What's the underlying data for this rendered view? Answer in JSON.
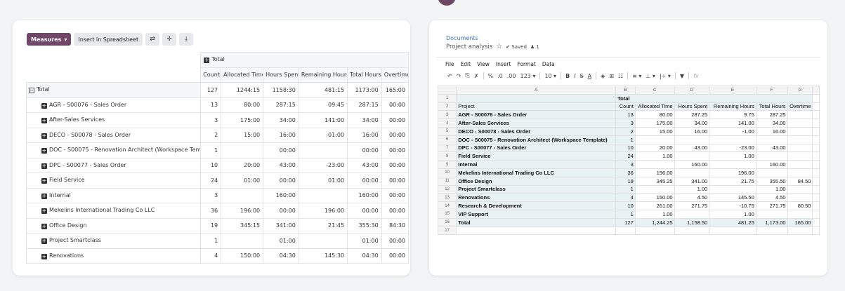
{
  "pivot": {
    "toolbar": {
      "measures": "Measures",
      "insert": "Insert in Spreadsheet",
      "icons": [
        "swap-axis-icon",
        "expand-all-icon",
        "download-icon"
      ]
    },
    "header_total": "Total",
    "columns": [
      "Count",
      "Allocated Time",
      "Hours Spent",
      "Remaining Hours",
      "Total Hours",
      "Overtime"
    ],
    "total_row": {
      "label": "Total",
      "values": [
        "127",
        "1244:15",
        "1158:30",
        "481:15",
        "1173:00",
        "165:00"
      ]
    },
    "rows": [
      {
        "label": "AGR - S00076 - Sales Order",
        "values": [
          "13",
          "80:00",
          "287:15",
          "09:45",
          "287:15",
          "00:00"
        ]
      },
      {
        "label": "After-Sales Services",
        "values": [
          "3",
          "175:00",
          "34:00",
          "141:00",
          "34:00",
          "00:00"
        ]
      },
      {
        "label": "DECO - S00078 - Sales Order",
        "values": [
          "2",
          "15:00",
          "16:00",
          "-01:00",
          "16:00",
          "00:00"
        ]
      },
      {
        "label": "DOC - S00075 - Renovation Architect (Workspace Template)",
        "values": [
          "1",
          "",
          "00:00",
          "",
          "00:00",
          "00:00"
        ]
      },
      {
        "label": "DPC - S00077 - Sales Order",
        "values": [
          "10",
          "20:00",
          "43:00",
          "-23:00",
          "43:00",
          "00:00"
        ]
      },
      {
        "label": "Field Service",
        "values": [
          "24",
          "01:00",
          "00:00",
          "01:00",
          "00:00",
          "00:00"
        ]
      },
      {
        "label": "Internal",
        "values": [
          "3",
          "",
          "160:00",
          "",
          "160:00",
          "00:00"
        ]
      },
      {
        "label": "Mekelins International Trading Co LLC",
        "values": [
          "36",
          "196:00",
          "00:00",
          "196:00",
          "00:00",
          "00:00"
        ]
      },
      {
        "label": "Office Design",
        "values": [
          "19",
          "345:15",
          "341:00",
          "21:45",
          "355:30",
          "84:30"
        ]
      },
      {
        "label": "Project Smartclass",
        "values": [
          "1",
          "",
          "01:00",
          "",
          "01:00",
          "00:00"
        ]
      },
      {
        "label": "Renovations",
        "values": [
          "4",
          "150:00",
          "04:30",
          "145:30",
          "04:30",
          "00:00"
        ]
      }
    ]
  },
  "spreadsheet": {
    "breadcrumb": "Documents",
    "title": "Project analysis",
    "saved": "Saved",
    "user_count": "1",
    "menu": [
      "File",
      "Edit",
      "View",
      "Insert",
      "Format",
      "Data"
    ],
    "toolbar": [
      "↶",
      "↷",
      "⎘",
      "✗",
      "%",
      ".0",
      ".00",
      "123 ▾",
      "10 ▾",
      "B",
      "I",
      "S",
      "A",
      "◈",
      "⊞",
      "☷",
      "≡ ▾",
      "⊥ ▾",
      "|÷ ▾",
      "▼",
      "fx"
    ],
    "col_letters": [
      "A",
      "B",
      "C",
      "D",
      "E",
      "F",
      "G"
    ],
    "row_numbers": [
      "1",
      "2",
      "3",
      "4",
      "5",
      "6",
      "7",
      "8",
      "9",
      "10",
      "11",
      "12",
      "13",
      "14",
      "15",
      "16",
      "17"
    ],
    "header_total": "Total",
    "header_project": "Project",
    "header_cols": [
      "Count",
      "Allocated Time",
      "Hours Spent",
      "Remaining Hours",
      "Total Hours",
      "Overtime"
    ],
    "rows": [
      {
        "label": "AGR - S00076 - Sales Order",
        "values": [
          "13",
          "80.00",
          "287.25",
          "9.75",
          "287.25",
          ""
        ]
      },
      {
        "label": "After-Sales Services",
        "values": [
          "3",
          "175.00",
          "34.00",
          "141.00",
          "34.00",
          ""
        ]
      },
      {
        "label": "DECO - S00078 - Sales Order",
        "values": [
          "2",
          "15.00",
          "16.00",
          "-1.00",
          "16.00",
          ""
        ]
      },
      {
        "label": "DOC - S00075 - Renovation Architect (Workspace Template)",
        "values": [
          "1",
          "",
          "",
          "",
          "",
          ""
        ]
      },
      {
        "label": "DPC - S00077 - Sales Order",
        "values": [
          "10",
          "20.00",
          "43.00",
          "-23.00",
          "43.00",
          ""
        ]
      },
      {
        "label": "Field Service",
        "values": [
          "24",
          "1.00",
          "",
          "1.00",
          "",
          ""
        ]
      },
      {
        "label": "Internal",
        "values": [
          "3",
          "",
          "160.00",
          "",
          "160.00",
          ""
        ]
      },
      {
        "label": "Mekelins International Trading Co LLC",
        "values": [
          "36",
          "196.00",
          "",
          "196.00",
          "",
          ""
        ]
      },
      {
        "label": "Office Design",
        "values": [
          "19",
          "345.25",
          "341.00",
          "21.75",
          "355.50",
          "84.50"
        ]
      },
      {
        "label": "Project Smartclass",
        "values": [
          "1",
          "",
          "1.00",
          "",
          "1.00",
          ""
        ]
      },
      {
        "label": "Renovations",
        "values": [
          "4",
          "150.00",
          "4.50",
          "145.50",
          "4.50",
          ""
        ]
      },
      {
        "label": "Research & Development",
        "values": [
          "10",
          "261.00",
          "271.75",
          "-10.75",
          "271.75",
          "80.50"
        ]
      },
      {
        "label": "VIP Support",
        "values": [
          "1",
          "1.00",
          "",
          "1.00",
          "",
          ""
        ]
      }
    ],
    "total_row": {
      "label": "Total",
      "values": [
        "127",
        "1,244.25",
        "1,158.50",
        "481.25",
        "1,173.00",
        "165.00"
      ]
    }
  }
}
